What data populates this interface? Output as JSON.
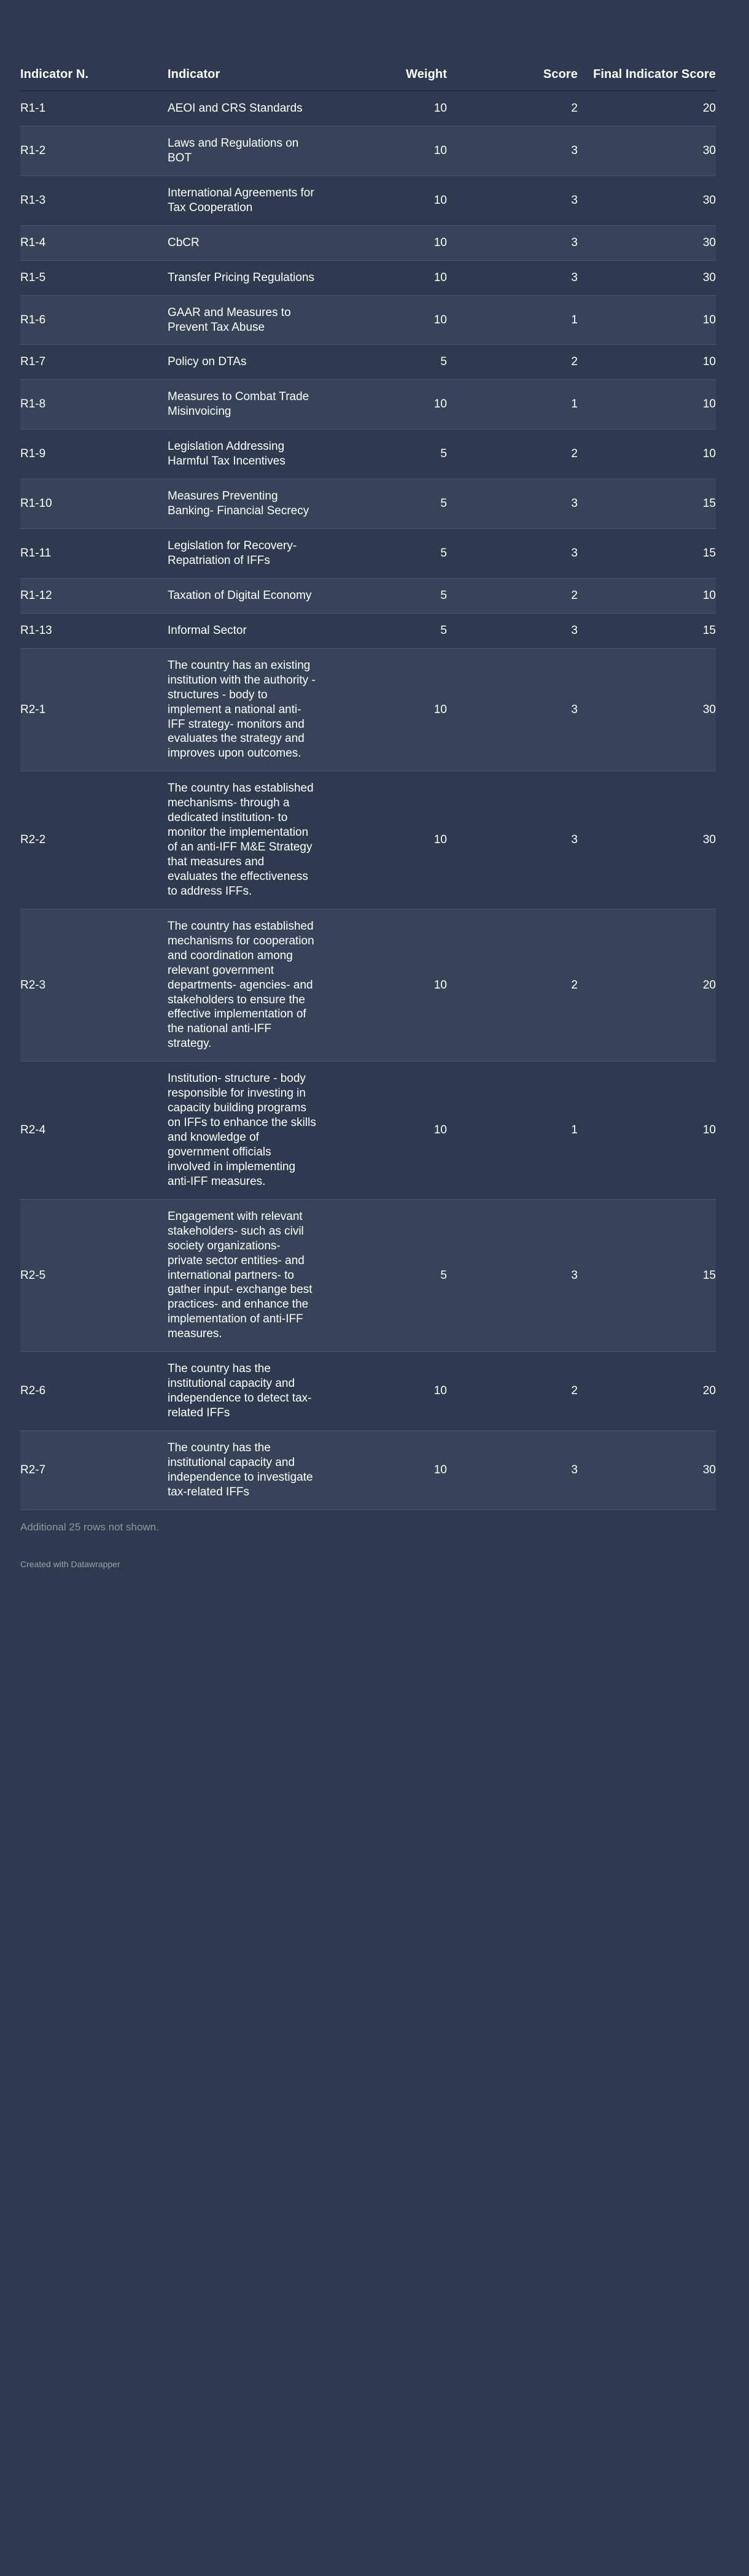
{
  "table": {
    "columns": [
      {
        "label": "Indicator N.",
        "align": "left"
      },
      {
        "label": "Indicator",
        "align": "left"
      },
      {
        "label": "Weight",
        "align": "right"
      },
      {
        "label": "Score",
        "align": "right"
      },
      {
        "label": "Final Indicator Score",
        "align": "right"
      }
    ],
    "rows": [
      {
        "id": "R1-1",
        "indicator": "AEOI and CRS Standards",
        "weight": "10",
        "score": "2",
        "final": "20"
      },
      {
        "id": "R1-2",
        "indicator": "Laws and Regulations on BOT",
        "weight": "10",
        "score": "3",
        "final": "30"
      },
      {
        "id": "R1-3",
        "indicator": "International Agreements for Tax Cooperation",
        "weight": "10",
        "score": "3",
        "final": "30"
      },
      {
        "id": "R1-4",
        "indicator": "CbCR",
        "weight": "10",
        "score": "3",
        "final": "30"
      },
      {
        "id": "R1-5",
        "indicator": "Transfer Pricing Regulations",
        "weight": "10",
        "score": "3",
        "final": "30"
      },
      {
        "id": "R1-6",
        "indicator": "GAAR and Measures to Prevent Tax Abuse",
        "weight": "10",
        "score": "1",
        "final": "10"
      },
      {
        "id": "R1-7",
        "indicator": "Policy on DTAs",
        "weight": "5",
        "score": "2",
        "final": "10"
      },
      {
        "id": "R1-8",
        "indicator": "Measures to Combat Trade Misinvoicing",
        "weight": "10",
        "score": "1",
        "final": "10"
      },
      {
        "id": "R1-9",
        "indicator": "Legislation Addressing Harmful Tax Incentives",
        "weight": "5",
        "score": "2",
        "final": "10"
      },
      {
        "id": "R1-10",
        "indicator": "Measures Preventing Banking- Financial Secrecy",
        "weight": "5",
        "score": "3",
        "final": "15"
      },
      {
        "id": "R1-11",
        "indicator": "Legislation for Recovery- Repatriation of IFFs",
        "weight": "5",
        "score": "3",
        "final": "15"
      },
      {
        "id": "R1-12",
        "indicator": "Taxation of Digital Economy",
        "weight": "5",
        "score": "2",
        "final": "10"
      },
      {
        "id": "R1-13",
        "indicator": "Informal Sector",
        "weight": "5",
        "score": "3",
        "final": "15"
      },
      {
        "id": "R2-1",
        "indicator": "The country has an existing institution with the authority - structures - body to implement a national anti-IFF strategy- monitors and evaluates the strategy and improves upon outcomes.",
        "weight": "10",
        "score": "3",
        "final": "30"
      },
      {
        "id": "R2-2",
        "indicator": "The country has established mechanisms- through a dedicated institution- to monitor the implementation of an anti-IFF M&E Strategy that measures and evaluates the effectiveness to address IFFs.",
        "weight": "10",
        "score": "3",
        "final": "30"
      },
      {
        "id": "R2-3",
        "indicator": "The country has established mechanisms for cooperation and coordination among relevant government departments- agencies- and stakeholders to ensure the effective implementation of the national anti-IFF strategy.",
        "weight": "10",
        "score": "2",
        "final": "20"
      },
      {
        "id": "R2-4",
        "indicator": "Institution- structure - body responsible for investing in capacity building programs on IFFs to enhance the skills and knowledge of government officials involved in implementing anti-IFF measures.",
        "weight": "10",
        "score": "1",
        "final": "10"
      },
      {
        "id": "R2-5",
        "indicator": "Engagement with relevant stakeholders- such as civil society organizations- private sector entities- and international partners- to gather input- exchange best practices- and enhance the implementation of anti-IFF measures.",
        "weight": "5",
        "score": "3",
        "final": "15"
      },
      {
        "id": "R2-6",
        "indicator": "The country has the institutional capacity and independence to detect tax-related IFFs",
        "weight": "10",
        "score": "2",
        "final": "20"
      },
      {
        "id": "R2-7",
        "indicator": "The country has the institutional capacity and independence to investigate tax-related IFFs",
        "weight": "10",
        "score": "3",
        "final": "30"
      }
    ]
  },
  "footer": {
    "rows_not_shown": "Additional 25 rows not shown.",
    "credit": "Created with Datawrapper"
  },
  "colors": {
    "background": "#2e3a4d",
    "stripe": "#374458",
    "text": "#ffffff",
    "muted": "#8c96a5",
    "header_rule": "#232b38",
    "row_rule": "#4b5768"
  }
}
